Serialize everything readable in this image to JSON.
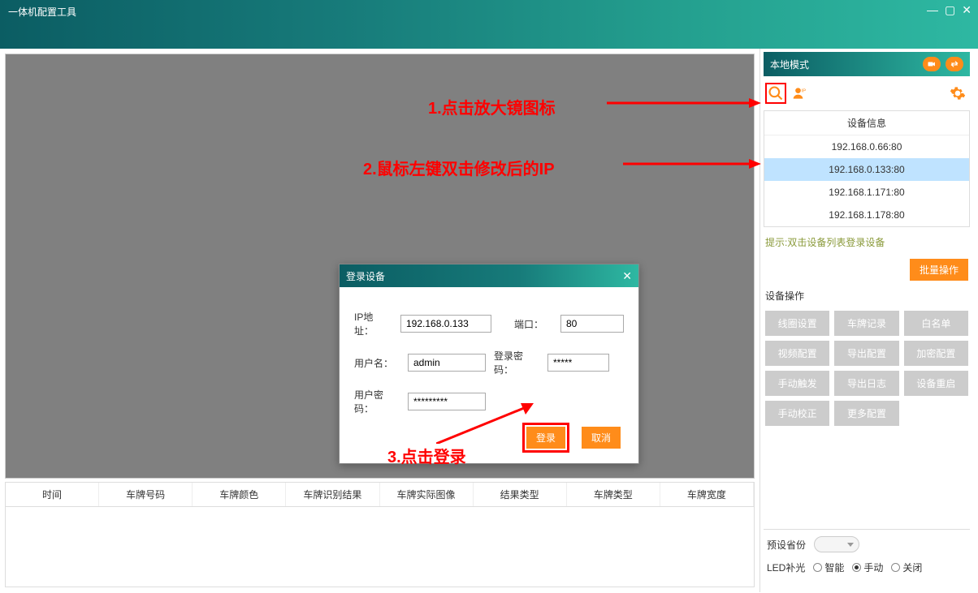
{
  "app": {
    "title": "一体机配置工具"
  },
  "sidebar": {
    "mode_label": "本地模式",
    "device_info_header": "设备信息",
    "devices": [
      {
        "addr": "192.168.0.66:80"
      },
      {
        "addr": "192.168.0.133:80"
      },
      {
        "addr": "192.168.1.171:80"
      },
      {
        "addr": "192.168.1.178:80"
      }
    ],
    "selected_index": 1,
    "hint": "提示:双击设备列表登录设备",
    "batch_label": "批量操作",
    "ops_title": "设备操作",
    "ops": [
      "线圈设置",
      "车牌记录",
      "白名单",
      "视频配置",
      "导出配置",
      "加密配置",
      "手动触发",
      "导出日志",
      "设备重启",
      "手动校正",
      "更多配置"
    ],
    "preset_label": "预设省份",
    "led_label": "LED补光",
    "led_options": [
      "智能",
      "手动",
      "关闭"
    ],
    "led_selected": "手动"
  },
  "table": {
    "columns": [
      "时间",
      "车牌号码",
      "车牌颜色",
      "车牌识别结果",
      "车牌实际图像",
      "结果类型",
      "车牌类型",
      "车牌宽度"
    ]
  },
  "dialog": {
    "title": "登录设备",
    "labels": {
      "ip": "IP地址：",
      "port": "端口：",
      "user": "用户名：",
      "login_pwd": "登录密码：",
      "user_pwd": "用户密码："
    },
    "values": {
      "ip": "192.168.0.133",
      "port": "80",
      "user": "admin",
      "login_pwd": "*****",
      "user_pwd": "*********"
    },
    "buttons": {
      "login": "登录",
      "cancel": "取消"
    }
  },
  "annotations": {
    "step1": "1.点击放大镜图标",
    "step2": "2.鼠标左键双击修改后的IP",
    "step3": "3.点击登录"
  }
}
